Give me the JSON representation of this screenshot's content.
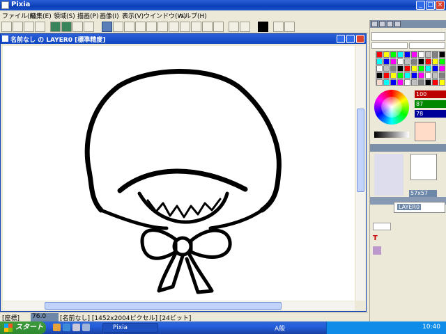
{
  "app": {
    "title": "Pixia",
    "menu": [
      "ファイル(F)",
      "編集(E)",
      "領域(S)",
      "描画(P)",
      "画像(I)",
      "表示(V)",
      "ウインドウ(W)",
      "ヘルプ(H)"
    ]
  },
  "document": {
    "title": "名前なし の LAYER0 [標準精度]"
  },
  "status": {
    "label": "[座標]",
    "zoom": "76.0",
    "info": "[名前なし] [1452x2004ピクセル] [24ビット]"
  },
  "panels": {
    "rgb": [
      "100",
      "87",
      "78"
    ],
    "brush_size": "57x57",
    "layer_name": "LAYER0",
    "colors": {
      "swatch_selected": "#f8d8c8",
      "current": "#ffdcc8"
    }
  },
  "taskbar": {
    "start_label": "スタート",
    "task_label": "Pixia",
    "ime": "A般",
    "clock": "10:40"
  }
}
